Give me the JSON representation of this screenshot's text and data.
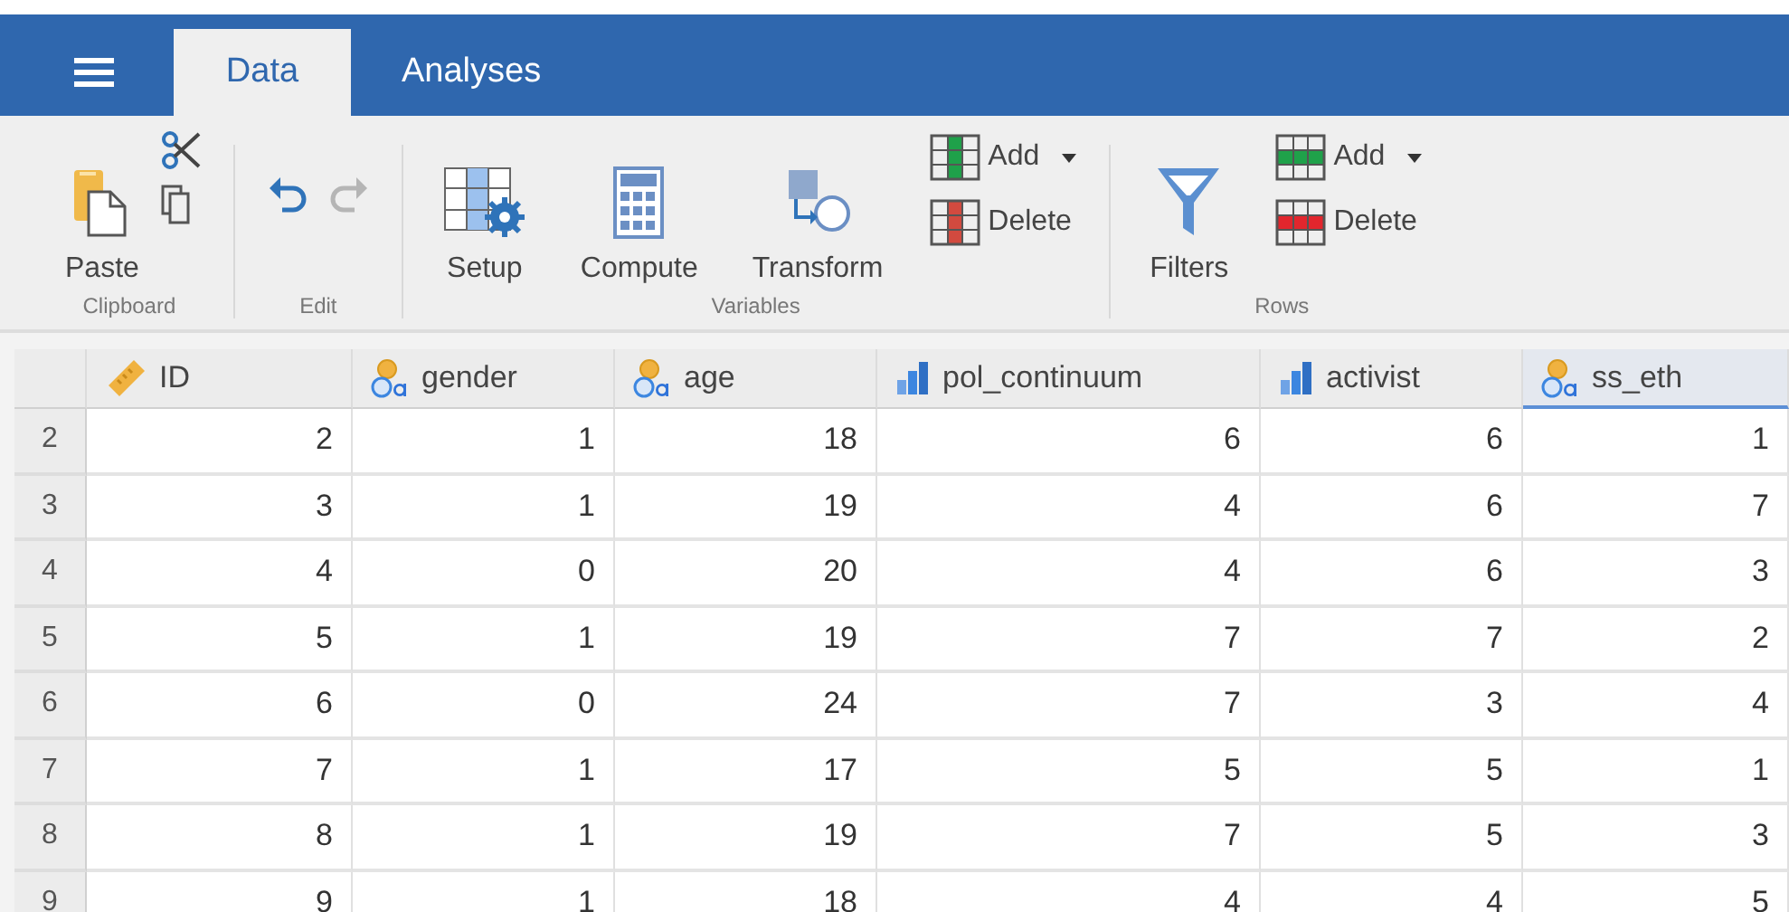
{
  "tabs": [
    {
      "label": "Data",
      "selected": true
    },
    {
      "label": "Analyses",
      "selected": false
    }
  ],
  "ribbon": {
    "groups": [
      {
        "label": "Clipboard",
        "tools": [
          {
            "kind": "paste",
            "label": "Paste"
          },
          {
            "kind": "cut"
          },
          {
            "kind": "copy"
          }
        ]
      },
      {
        "label": "Edit",
        "tools": [
          {
            "kind": "undo"
          },
          {
            "kind": "redo",
            "disabled": true
          }
        ]
      },
      {
        "label": "Variables",
        "tools": [
          {
            "kind": "setup",
            "label": "Setup"
          },
          {
            "kind": "compute",
            "label": "Compute"
          },
          {
            "kind": "transform",
            "label": "Transform"
          },
          {
            "kind": "col-add",
            "label": "Add",
            "dropdown": true
          },
          {
            "kind": "col-delete",
            "label": "Delete"
          }
        ]
      },
      {
        "label": "Rows",
        "tools": [
          {
            "kind": "filters",
            "label": "Filters"
          },
          {
            "kind": "row-add",
            "label": "Add",
            "dropdown": true
          },
          {
            "kind": "row-delete",
            "label": "Delete"
          }
        ]
      }
    ]
  },
  "table": {
    "columns": [
      {
        "name": "ID",
        "kind": "id",
        "selected": false
      },
      {
        "name": "gender",
        "kind": "nominal",
        "selected": false
      },
      {
        "name": "age",
        "kind": "nominal",
        "selected": false
      },
      {
        "name": "pol_continuum",
        "kind": "continuous",
        "selected": false
      },
      {
        "name": "activist",
        "kind": "continuous",
        "selected": false
      },
      {
        "name": "ss_eth",
        "kind": "nominal",
        "selected": true
      }
    ],
    "rows": [
      {
        "number": "2",
        "cells": [
          "2",
          "1",
          "18",
          "6",
          "6",
          "1"
        ]
      },
      {
        "number": "3",
        "cells": [
          "3",
          "1",
          "19",
          "4",
          "6",
          "7"
        ]
      },
      {
        "number": "4",
        "cells": [
          "4",
          "0",
          "20",
          "4",
          "6",
          "3"
        ]
      },
      {
        "number": "5",
        "cells": [
          "5",
          "1",
          "19",
          "7",
          "7",
          "2"
        ]
      },
      {
        "number": "6",
        "cells": [
          "6",
          "0",
          "24",
          "7",
          "3",
          "4"
        ]
      },
      {
        "number": "7",
        "cells": [
          "7",
          "1",
          "17",
          "5",
          "5",
          "1"
        ]
      },
      {
        "number": "8",
        "cells": [
          "8",
          "1",
          "19",
          "7",
          "5",
          "3"
        ]
      },
      {
        "number": "9",
        "cells": [
          "9",
          "1",
          "18",
          "4",
          "4",
          "5"
        ]
      }
    ]
  }
}
